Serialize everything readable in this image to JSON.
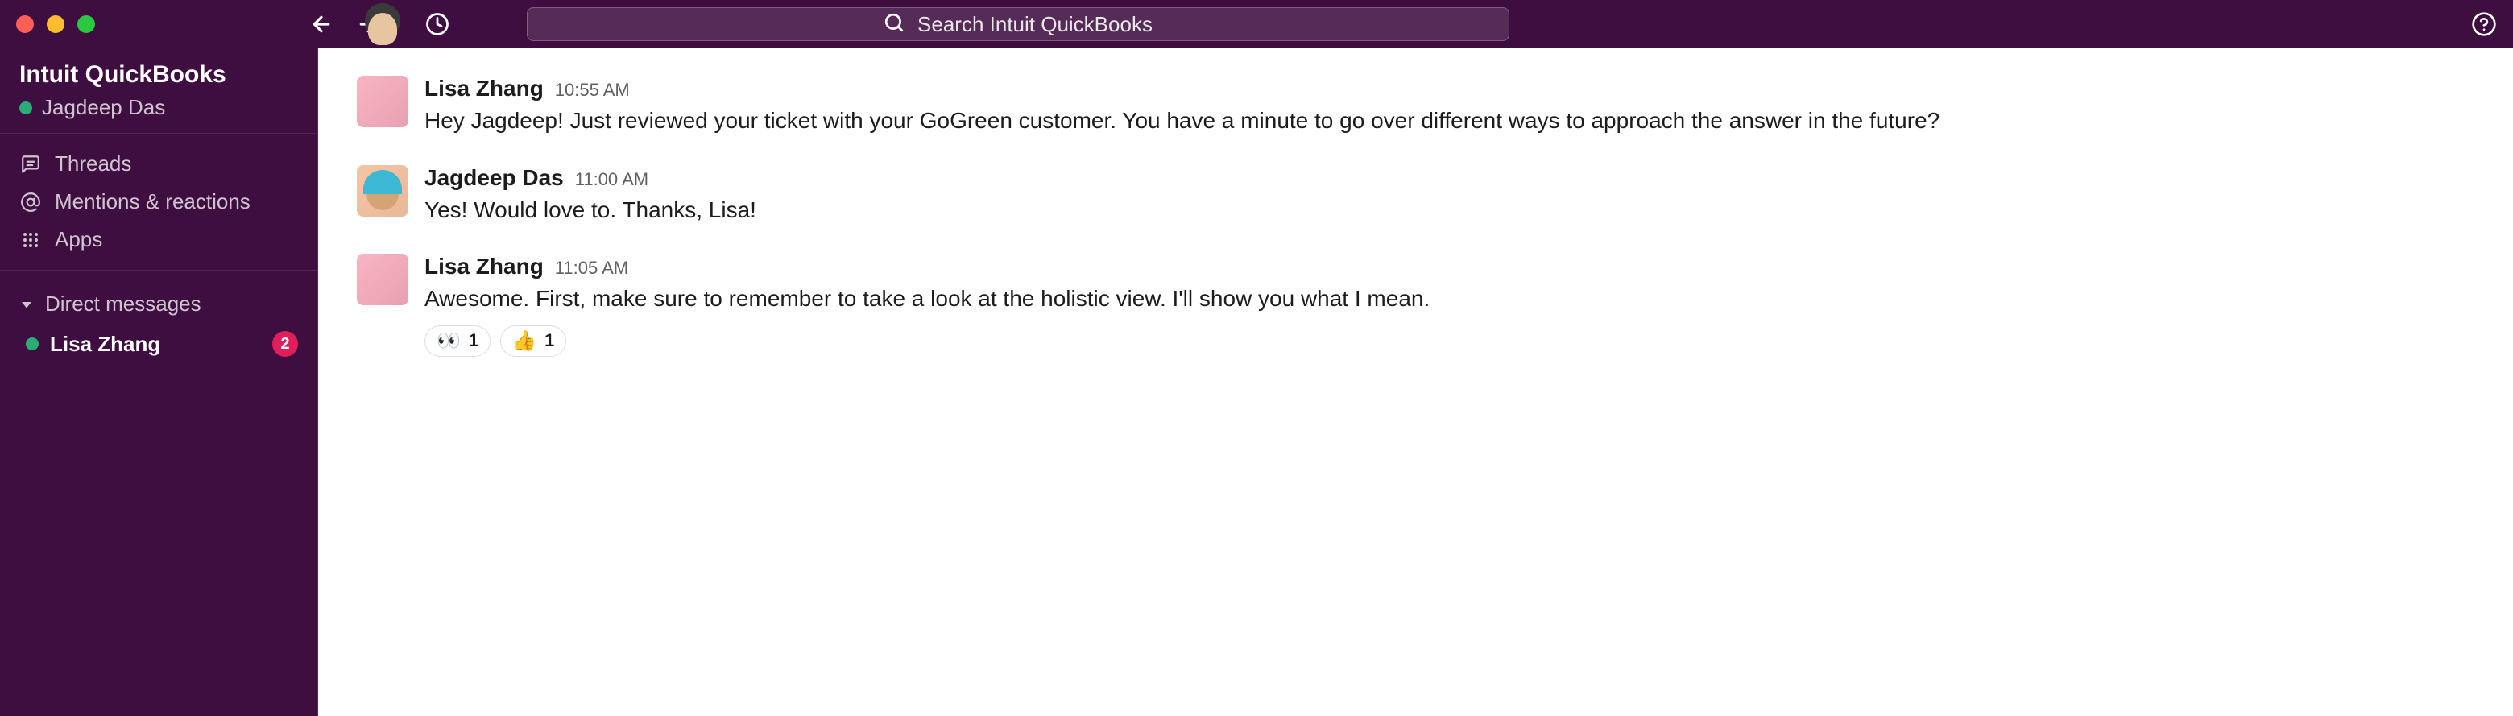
{
  "topbar": {
    "search_placeholder": "Search Intuit QuickBooks"
  },
  "sidebar": {
    "workspace_name": "Intuit QuickBooks",
    "current_user": "Jagdeep Das",
    "nav": {
      "threads": "Threads",
      "mentions": "Mentions & reactions",
      "apps": "Apps"
    },
    "dm_header": "Direct messages",
    "dms": [
      {
        "name": "Lisa Zhang",
        "badge": "2"
      }
    ]
  },
  "messages": [
    {
      "sender": "Lisa Zhang",
      "time": "10:55 AM",
      "text": "Hey Jagdeep! Just reviewed your ticket with your GoGreen customer. You have a minute to go over different ways to approach the answer in the future?",
      "avatar": "lisa"
    },
    {
      "sender": "Jagdeep Das",
      "time": "11:00 AM",
      "text": "Yes! Would love to. Thanks, Lisa!",
      "avatar": "jagdeep"
    },
    {
      "sender": "Lisa Zhang",
      "time": "11:05 AM",
      "text": "Awesome. First, make sure to remember to take a look at the holistic view. I'll show you what I mean.",
      "avatar": "lisa",
      "reactions": [
        {
          "emoji": "👀",
          "count": "1"
        },
        {
          "emoji": "👍",
          "count": "1"
        }
      ]
    }
  ]
}
